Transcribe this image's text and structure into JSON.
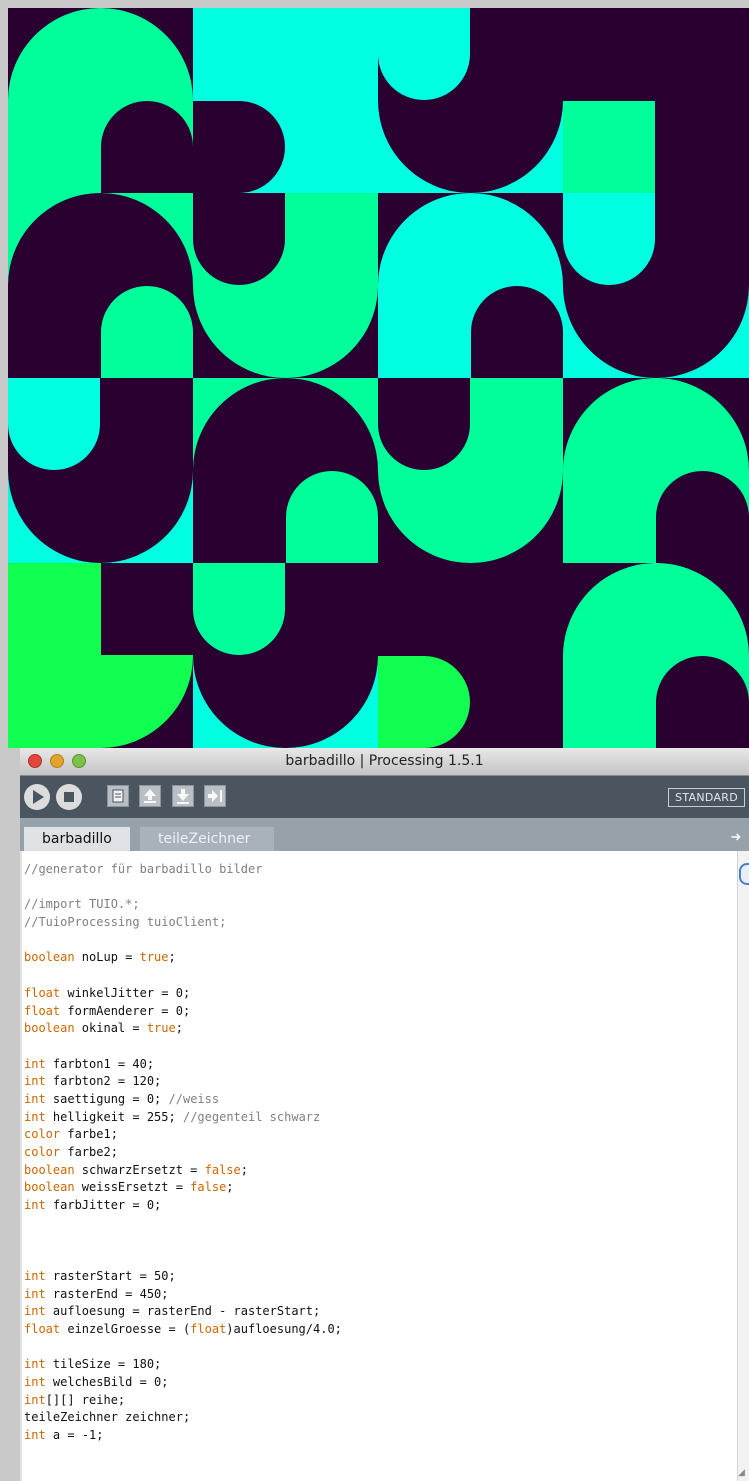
{
  "window": {
    "title": "barbadillo | Processing 1.5.1"
  },
  "toolbar": {
    "buttons": [
      {
        "name": "run-button",
        "icon": "play-icon"
      },
      {
        "name": "stop-button",
        "icon": "stop-icon"
      },
      {
        "name": "new-button",
        "icon": "new-file-icon"
      },
      {
        "name": "open-button",
        "icon": "open-up-arrow-icon"
      },
      {
        "name": "save-button",
        "icon": "save-down-arrow-icon"
      },
      {
        "name": "export-button",
        "icon": "export-arrow-icon"
      }
    ],
    "mode_label": "STANDARD"
  },
  "tabs": [
    {
      "label": "barbadillo",
      "active": true
    },
    {
      "label": "teileZeichner",
      "active": false
    }
  ],
  "code_lines": [
    [
      [
        "cm",
        "//generator für barbadillo bilder"
      ]
    ],
    [],
    [
      [
        "cm",
        "//import TUIO.*;"
      ]
    ],
    [
      [
        "cm",
        "//TuioProcessing tuioClient;"
      ]
    ],
    [],
    [
      [
        "kw",
        "boolean"
      ],
      [
        "tx",
        " noLup = "
      ],
      [
        "kw",
        "true"
      ],
      [
        "tx",
        ";"
      ]
    ],
    [],
    [
      [
        "kw",
        "float"
      ],
      [
        "tx",
        " winkelJitter = 0;"
      ]
    ],
    [
      [
        "kw",
        "float"
      ],
      [
        "tx",
        " formAenderer = 0;"
      ]
    ],
    [
      [
        "kw",
        "boolean"
      ],
      [
        "tx",
        " okinal = "
      ],
      [
        "kw",
        "true"
      ],
      [
        "tx",
        ";"
      ]
    ],
    [],
    [
      [
        "kw",
        "int"
      ],
      [
        "tx",
        " farbton1 = 40;"
      ]
    ],
    [
      [
        "kw",
        "int"
      ],
      [
        "tx",
        " farbton2 = 120;"
      ]
    ],
    [
      [
        "kw",
        "int"
      ],
      [
        "tx",
        " saettigung = 0; "
      ],
      [
        "cm",
        "//weiss"
      ]
    ],
    [
      [
        "kw",
        "int"
      ],
      [
        "tx",
        " helligkeit = 255; "
      ],
      [
        "cm",
        "//gegenteil schwarz"
      ]
    ],
    [
      [
        "kw",
        "color"
      ],
      [
        "tx",
        " farbe1;"
      ]
    ],
    [
      [
        "kw",
        "color"
      ],
      [
        "tx",
        " farbe2;"
      ]
    ],
    [
      [
        "kw",
        "boolean"
      ],
      [
        "tx",
        " schwarzErsetzt = "
      ],
      [
        "kw",
        "false"
      ],
      [
        "tx",
        ";"
      ]
    ],
    [
      [
        "kw",
        "boolean"
      ],
      [
        "tx",
        " weissErsetzt = "
      ],
      [
        "kw",
        "false"
      ],
      [
        "tx",
        ";"
      ]
    ],
    [
      [
        "kw",
        "int"
      ],
      [
        "tx",
        " farbJitter = 0;"
      ]
    ],
    [],
    [],
    [],
    [
      [
        "kw",
        "int"
      ],
      [
        "tx",
        " rasterStart = 50;"
      ]
    ],
    [
      [
        "kw",
        "int"
      ],
      [
        "tx",
        " rasterEnd = 450;"
      ]
    ],
    [
      [
        "kw",
        "int"
      ],
      [
        "tx",
        " aufloesung = rasterEnd - rasterStart;"
      ]
    ],
    [
      [
        "kw",
        "float"
      ],
      [
        "tx",
        " einzelGroesse = ("
      ],
      [
        "kw",
        "float"
      ],
      [
        "tx",
        ")aufloesung/4.0;"
      ]
    ],
    [],
    [
      [
        "kw",
        "int"
      ],
      [
        "tx",
        " tileSize = 180;"
      ]
    ],
    [
      [
        "kw",
        "int"
      ],
      [
        "tx",
        " welchesBild = 0;"
      ]
    ],
    [
      [
        "kw",
        "int"
      ],
      [
        "tx",
        "[][] reihe;"
      ]
    ],
    [
      [
        "tx",
        "teileZeichner zeichner;"
      ]
    ],
    [
      [
        "kw",
        "int"
      ],
      [
        "tx",
        " a = -1;"
      ]
    ]
  ],
  "colors": {
    "sketch_dark": "#2a0030",
    "sketch_green": "#00ff9a",
    "sketch_cyan": "#00ffe0",
    "sketch_bright_green": "#10ff50",
    "keyword": "#cc6600",
    "comment": "#808080"
  }
}
